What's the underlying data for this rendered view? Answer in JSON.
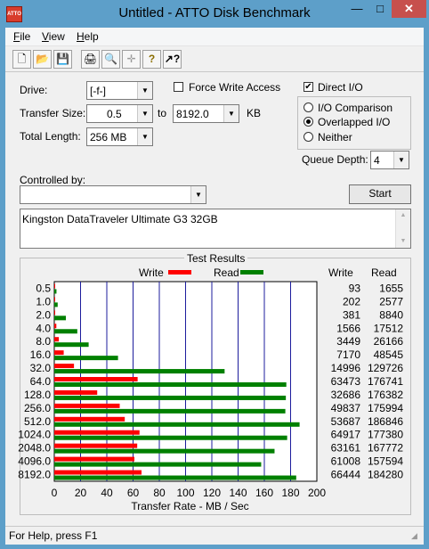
{
  "window": {
    "title": "Untitled - ATTO Disk Benchmark",
    "app_icon_text": "ATTO",
    "min_glyph": "—",
    "max_glyph": "□",
    "close_glyph": "✕"
  },
  "menu": [
    {
      "key": "F",
      "rest": "ile"
    },
    {
      "key": "V",
      "rest": "iew"
    },
    {
      "key": "H",
      "rest": "elp"
    }
  ],
  "toolbar": {
    "icons": [
      "new-icon",
      "open-icon",
      "save-icon",
      "print-icon",
      "print-preview-icon",
      "move-icon",
      "help-icon",
      "context-help-icon"
    ],
    "glyphs": [
      "🗋",
      "📂",
      "💾",
      "🖨",
      "🔍",
      "✛",
      "?",
      "↗?"
    ]
  },
  "settings": {
    "drive_label": "Drive:",
    "drive_value": "[-f-]",
    "force_write_label": "Force Write Access",
    "force_write_checked": false,
    "direct_io_label": "Direct I/O",
    "direct_io_checked": true,
    "transfer_size_label": "Transfer Size:",
    "transfer_from": "0.5",
    "to_label": "to",
    "transfer_to": "8192.0",
    "kb_label": "KB",
    "total_length_label": "Total Length:",
    "total_length_value": "256 MB",
    "io_options": [
      {
        "label": "I/O Comparison",
        "selected": false
      },
      {
        "label": "Overlapped I/O",
        "selected": true
      },
      {
        "label": "Neither",
        "selected": false
      }
    ],
    "queue_depth_label": "Queue Depth:",
    "queue_depth_value": "4",
    "controlled_by_label": "Controlled by:",
    "controlled_by_value": "",
    "start_label": "Start",
    "description": "Kingston DataTraveler Ultimate G3 32GB"
  },
  "results": {
    "group_title": "Test Results",
    "write_legend": "Write",
    "read_legend": "Read",
    "write_col": "Write",
    "read_col": "Read"
  },
  "chart_data": {
    "type": "bar",
    "orientation": "horizontal",
    "categories": [
      "0.5",
      "1.0",
      "2.0",
      "4.0",
      "8.0",
      "16.0",
      "32.0",
      "64.0",
      "128.0",
      "256.0",
      "512.0",
      "1024.0",
      "2048.0",
      "4096.0",
      "8192.0"
    ],
    "series": [
      {
        "name": "Write",
        "color": "#ff0000",
        "values": [
          93,
          202,
          381,
          1566,
          3449,
          7170,
          14996,
          63473,
          32686,
          49837,
          53687,
          64917,
          63161,
          61008,
          66444
        ]
      },
      {
        "name": "Read",
        "color": "#008000",
        "values": [
          1655,
          2577,
          8840,
          17512,
          26166,
          48545,
          129726,
          176741,
          176382,
          175994,
          186846,
          177380,
          167772,
          157594,
          184280
        ]
      }
    ],
    "xlabel": "Transfer Rate - MB / Sec",
    "xlim": [
      0,
      200
    ],
    "xticks": [
      "0",
      "20",
      "40",
      "60",
      "80",
      "100",
      "120",
      "140",
      "160",
      "180",
      "200"
    ],
    "grid": true,
    "legend": "top"
  },
  "status": {
    "text": "For Help, press F1"
  }
}
